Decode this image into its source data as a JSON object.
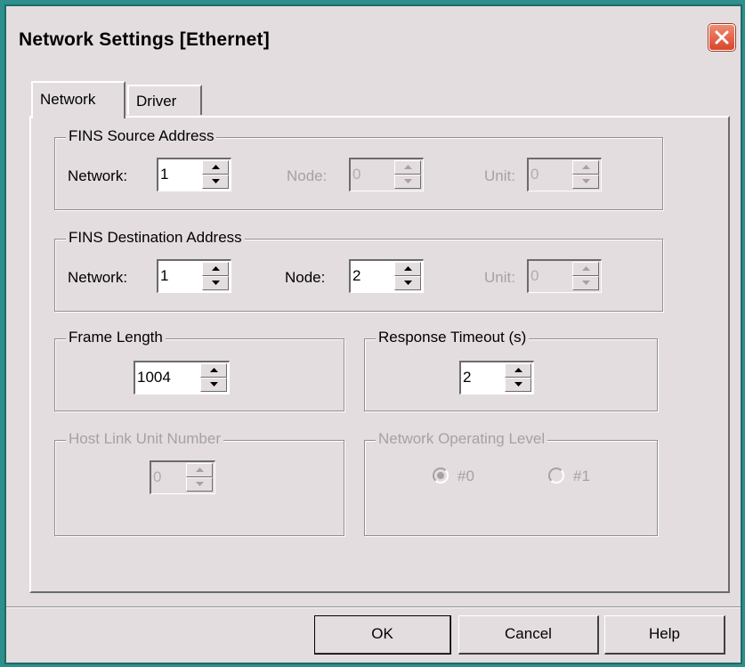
{
  "window": {
    "title": "Network Settings [Ethernet]"
  },
  "tabs": [
    {
      "label": "Network",
      "active": true
    },
    {
      "label": "Driver",
      "active": false
    }
  ],
  "fins_source": {
    "title": "FINS Source Address",
    "network": {
      "label": "Network:",
      "value": "1",
      "enabled": true
    },
    "node": {
      "label": "Node:",
      "value": "0",
      "enabled": false
    },
    "unit": {
      "label": "Unit:",
      "value": "0",
      "enabled": false
    }
  },
  "fins_destination": {
    "title": "FINS Destination Address",
    "network": {
      "label": "Network:",
      "value": "1",
      "enabled": true
    },
    "node": {
      "label": "Node:",
      "value": "2",
      "enabled": true
    },
    "unit": {
      "label": "Unit:",
      "value": "0",
      "enabled": false
    }
  },
  "frame_length": {
    "title": "Frame Length",
    "value": "1004"
  },
  "response_timeout": {
    "title": "Response Timeout (s)",
    "value": "2"
  },
  "host_link": {
    "title": "Host Link Unit Number",
    "value": "0",
    "enabled": false
  },
  "operating_level": {
    "title": "Network Operating Level",
    "options": [
      {
        "label": "#0",
        "selected": true
      },
      {
        "label": "#1",
        "selected": false
      }
    ],
    "enabled": false
  },
  "buttons": {
    "ok": "OK",
    "cancel": "Cancel",
    "help": "Help"
  },
  "colors": {
    "desktop": "#2f8f8a",
    "dialog": "#e4dde0",
    "close_button": "#d9452a"
  }
}
